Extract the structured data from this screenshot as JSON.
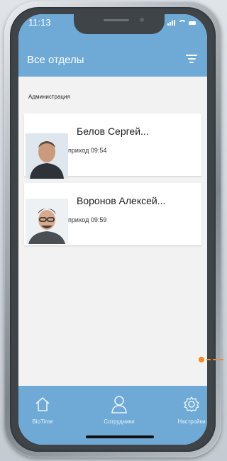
{
  "status": {
    "time": "11:13"
  },
  "header": {
    "title": "Все отделы"
  },
  "section": {
    "label": "Администрация"
  },
  "employees": [
    {
      "name": "Белов Сергей...",
      "time": "приход 09:54"
    },
    {
      "name": "Воронов Алексей...",
      "time": "приход 09:59"
    }
  ],
  "nav": {
    "items": [
      {
        "label": "BioTime",
        "icon": "home-icon"
      },
      {
        "label": "Сотрудники",
        "icon": "person-icon"
      },
      {
        "label": "Настройки",
        "icon": "gear-icon"
      }
    ]
  },
  "colors": {
    "accent": "#6fa9d5",
    "highlight": "#f28a1d"
  }
}
